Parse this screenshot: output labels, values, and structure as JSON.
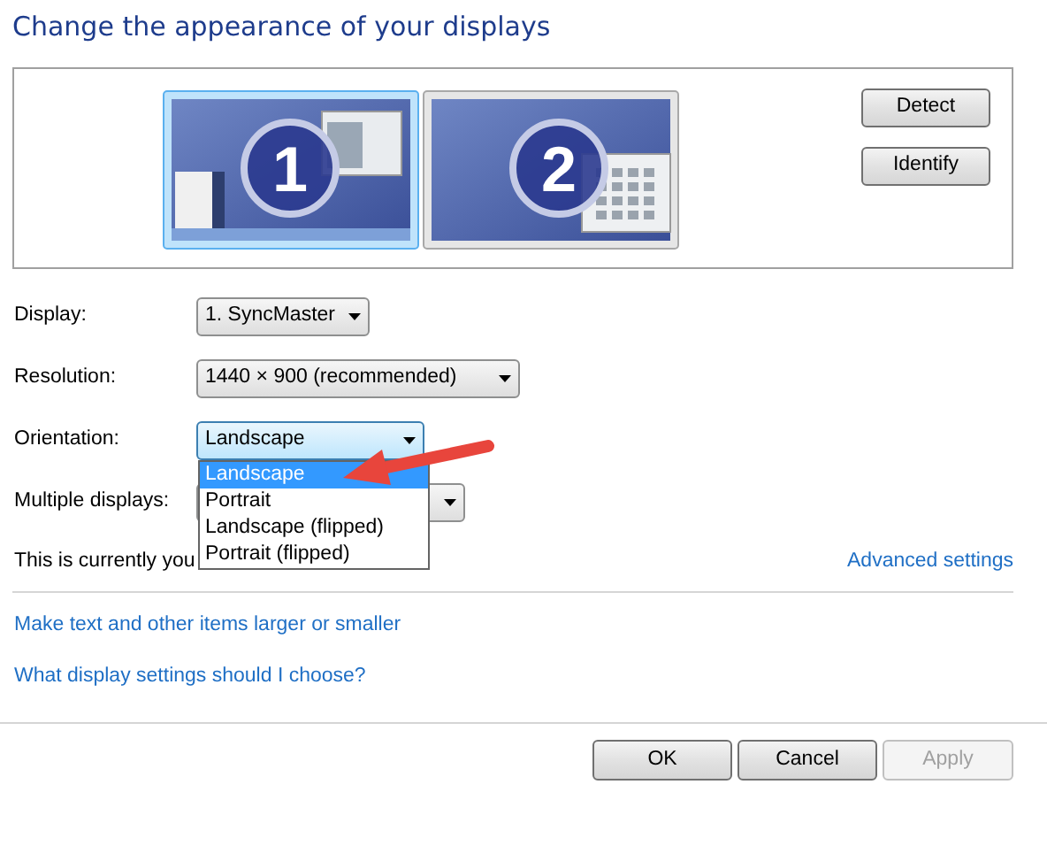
{
  "title": "Change the appearance of your displays",
  "monitors": [
    {
      "number": "1",
      "selected": true
    },
    {
      "number": "2",
      "selected": false
    }
  ],
  "side_buttons": [
    "Detect",
    "Identify"
  ],
  "settings": [
    {
      "label": "Display:",
      "value": "1. SyncMaster",
      "focused": false
    },
    {
      "label": "Resolution:",
      "value": "1440 × 900 (recommended)",
      "focused": false
    },
    {
      "label": "Orientation:",
      "value": "Landscape",
      "focused": true,
      "expanded": true,
      "options": [
        {
          "label": "Landscape",
          "selected": true
        },
        {
          "label": "Portrait",
          "selected": false
        },
        {
          "label": "Landscape (flipped)",
          "selected": false
        },
        {
          "label": "Portrait (flipped)",
          "selected": false
        }
      ]
    },
    {
      "label": "Multiple displays:",
      "focused": false
    }
  ],
  "status_text": "This is currently you",
  "advanced_link": "Advanced settings",
  "links": [
    "Make text and other items larger or smaller",
    "What display settings should I choose?"
  ],
  "buttons": [
    {
      "label": "OK",
      "disabled": false
    },
    {
      "label": "Cancel",
      "disabled": false
    },
    {
      "label": "Apply",
      "disabled": true
    }
  ]
}
